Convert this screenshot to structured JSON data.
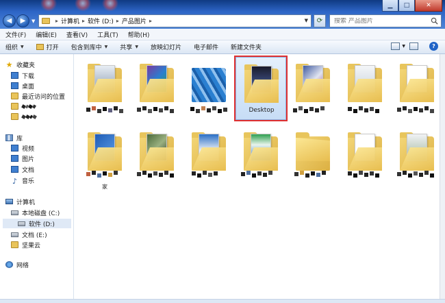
{
  "address": {
    "crumbs": [
      "计算机",
      "软件 (D:)",
      "产品图片"
    ]
  },
  "search": {
    "placeholder": "搜索 产品图片"
  },
  "menu": [
    "文件(F)",
    "编辑(E)",
    "查看(V)",
    "工具(T)",
    "帮助(H)"
  ],
  "commands": {
    "organize": "组织",
    "open": "打开",
    "include": "包含到库中",
    "share": "共享",
    "slideshow": "放映幻灯片",
    "email": "电子邮件",
    "new_folder": "新建文件夹"
  },
  "nav": {
    "favorites": "收藏夹",
    "downloads": "下载",
    "desktop": "桌面",
    "recent": "最近访问的位置",
    "library": "库",
    "videos": "视频",
    "pictures": "图片",
    "documents": "文档",
    "music": "音乐",
    "computer": "计算机",
    "drive_c": "本地磁盘 (C:)",
    "drive_d": "软件 (D:)",
    "drive_e": "文档 (E:)",
    "jianguoyun": "坚果云",
    "network": "网络"
  },
  "files": {
    "selected_label": "Desktop",
    "partial_label": "家"
  },
  "colors": {
    "selection_outline": "#e03030",
    "folder": "#e9c45a"
  }
}
